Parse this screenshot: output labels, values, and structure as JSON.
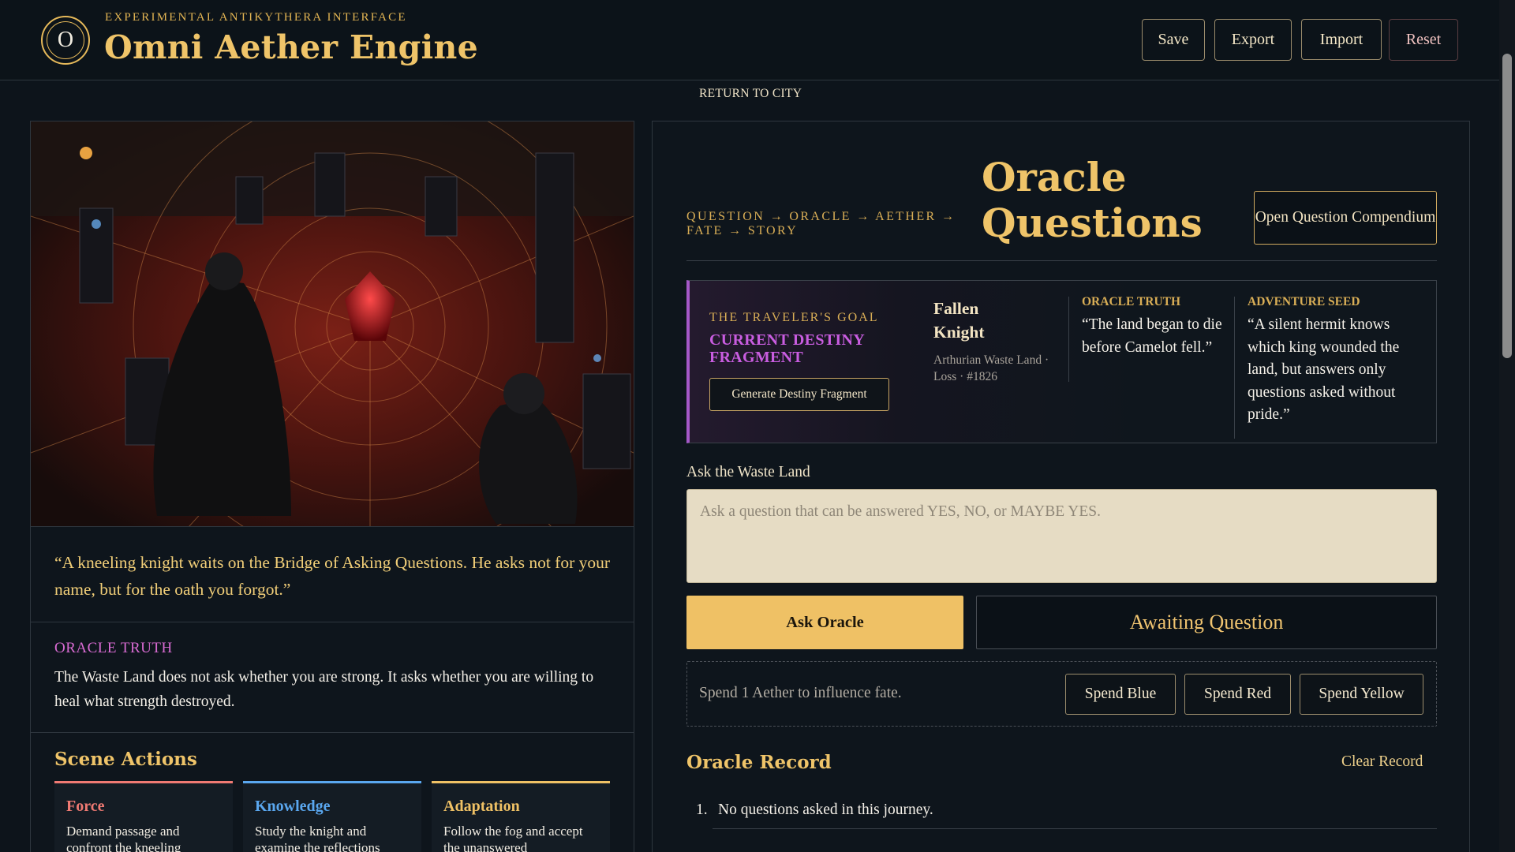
{
  "header": {
    "eyebrow": "EXPERIMENTAL ANTIKYTHERA INTERFACE",
    "title": "Omni Aether Engine",
    "logo_letter": "O",
    "buttons": {
      "save": "Save",
      "export": "Export",
      "import": "Import",
      "reset": "Reset"
    }
  },
  "nav": {
    "return_link": "RETURN TO CITY"
  },
  "scene": {
    "quote": "“A kneeling knight waits on the Bridge of Asking Questions. He asks not for your name, but for the oath you forgot.”",
    "truth_label": "ORACLE TRUTH",
    "truth_text": "The Waste Land does not ask whether you are strong. It asks whether you are willing to heal what strength destroyed.",
    "actions_title": "Scene Actions",
    "actions": [
      {
        "title": "Force",
        "desc": "Demand passage and confront the kneeling",
        "color": "#f07a73"
      },
      {
        "title": "Knowledge",
        "desc": "Study the knight and examine the reflections",
        "color": "#5aa7ef"
      },
      {
        "title": "Adaptation",
        "desc": "Follow the fog and accept the unanswered",
        "color": "#efc165"
      }
    ]
  },
  "oracle": {
    "pipeline": "QUESTION → ORACLE → AETHER → FATE → STORY",
    "title": "Oracle Questions",
    "compendium_button": "Open Question Compendium",
    "goal_label": "THE TRAVELER'S GOAL",
    "fragment_title": "CURRENT DESTINY FRAGMENT",
    "generate_button": "Generate Destiny Fragment",
    "fragment_name": "Fallen Knight",
    "fragment_meta": "Arthurian Waste Land · Loss · #1826",
    "truth_label": "ORACLE TRUTH",
    "truth_text": "“The land began to die before Camelot fell.”",
    "seed_label": "ADVENTURE SEED",
    "seed_text": "“A silent hermit knows which king wounded the land, but answers only questions asked without pride.”",
    "ask_label": "Ask the Waste Land",
    "ask_placeholder": "Ask a question that can be answered YES, NO, or MAYBE YES.",
    "ask_button": "Ask Oracle",
    "status": "Awaiting Question",
    "spend_text": "Spend 1 Aether to influence fate.",
    "spend_buttons": {
      "blue": "Spend Blue",
      "red": "Spend Red",
      "yellow": "Spend Yellow"
    },
    "record_title": "Oracle Record",
    "clear_button": "Clear Record",
    "record": [
      {
        "num": "1.",
        "text": "No questions asked in this journey."
      }
    ]
  },
  "colors": {
    "accent_gold": "#efc469",
    "magenta": "#c95de0",
    "background": "#0d141b"
  }
}
